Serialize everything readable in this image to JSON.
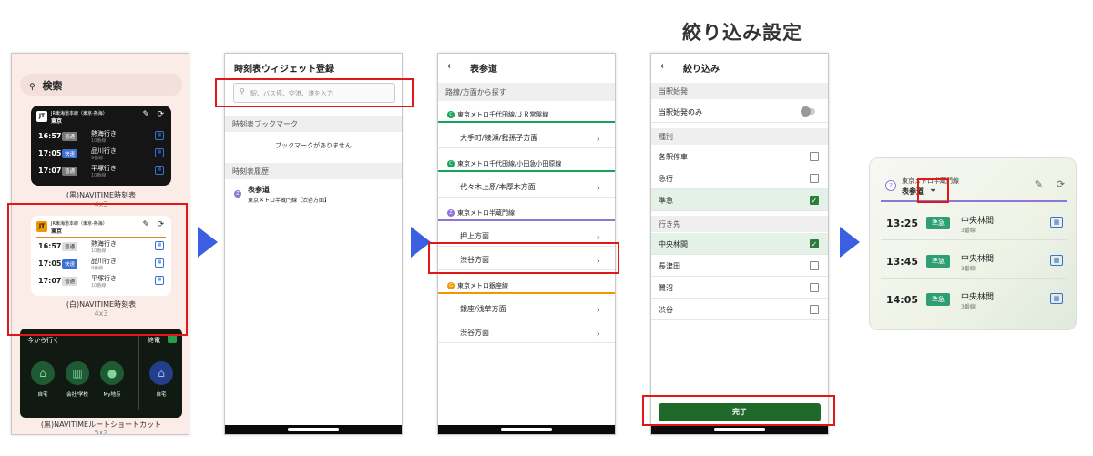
{
  "heading": "絞り込み設定",
  "colors": {
    "accent": "#2c7d3a",
    "highlight": "#e01818",
    "arrow": "#3a5fe0",
    "chiyoda": "#19a35a",
    "hanzomon": "#8f76d6",
    "ginza": "#f39700"
  },
  "phone1": {
    "search_label": "検索",
    "widget_dark": {
      "line": "JR東海道本線（東京-熱海）",
      "station": "東京",
      "rows": [
        {
          "time": "16:57",
          "type": "普通",
          "dest": "熱海行き",
          "track": "10番線"
        },
        {
          "time": "17:05",
          "type": "快速",
          "dest": "品川行き",
          "track": "9番線"
        },
        {
          "time": "17:07",
          "type": "普通",
          "dest": "平塚行き",
          "track": "10番線"
        }
      ],
      "label": "(黒)NAVITIME時刻表",
      "size": "4x3"
    },
    "widget_light": {
      "line": "JR東海道本線（東京-熱海）",
      "station": "東京",
      "rows": [
        {
          "time": "16:57",
          "type": "普通",
          "dest": "熱海行き",
          "track": "10番線"
        },
        {
          "time": "17:05",
          "type": "快速",
          "dest": "品川行き",
          "track": "9番線"
        },
        {
          "time": "17:07",
          "type": "普通",
          "dest": "平塚行き",
          "track": "10番線"
        }
      ],
      "label": "(白)NAVITIME時刻表",
      "size": "4x3"
    },
    "shortcut": {
      "title": "今から行く",
      "last_train": "終電",
      "items": [
        "自宅",
        "会社/学校",
        "My地点",
        "自宅"
      ],
      "label": "(黒)NAVITIMEルートショートカット",
      "size": "5x2"
    }
  },
  "phone2": {
    "title": "時刻表ウィジェット登録",
    "search_placeholder": "駅、バス停、空港、港を入力",
    "bookmark_header": "時刻表ブックマーク",
    "bookmark_empty": "ブックマークがありません",
    "history_header": "時刻表履歴",
    "history_station": "表参道",
    "history_line": "東京メトロ半蔵門線【渋谷方面】"
  },
  "phone3": {
    "title": "表参道",
    "section": "路線/方面から探す",
    "lines": [
      {
        "badge": "C",
        "name": "東京メトロ千代田線/ＪＲ常盤線",
        "directions": [
          "大手町/綾瀬/我孫子方面"
        ]
      },
      {
        "badge": "C",
        "name": "東京メトロ千代田線/小田急小田原線",
        "directions": [
          "代々木上原/本厚木方面"
        ]
      },
      {
        "badge": "Z",
        "name": "東京メトロ半蔵門線",
        "directions": [
          "押上方面",
          "渋谷方面"
        ]
      },
      {
        "badge": "G",
        "name": "東京メトロ銀座線",
        "directions": [
          "銀座/浅草方面",
          "渋谷方面"
        ]
      }
    ]
  },
  "phone4": {
    "title": "絞り込み",
    "origin_header": "当駅始発",
    "origin_only": "当駅始発のみ",
    "type_header": "種別",
    "types": [
      {
        "label": "各駅停車",
        "checked": false
      },
      {
        "label": "急行",
        "checked": false
      },
      {
        "label": "準急",
        "checked": true
      }
    ],
    "dest_header": "行き先",
    "dests": [
      {
        "label": "中央林間",
        "checked": true
      },
      {
        "label": "長津田",
        "checked": false
      },
      {
        "label": "鷺沼",
        "checked": false
      },
      {
        "label": "渋谷",
        "checked": false
      }
    ],
    "done_button": "完了"
  },
  "result_widget": {
    "line": "東京メトロ半蔵門線",
    "station": "表参道",
    "rows": [
      {
        "time": "13:25",
        "type": "準急",
        "dest": "中央林間",
        "track": "3番線"
      },
      {
        "time": "13:45",
        "type": "準急",
        "dest": "中央林間",
        "track": "3番線"
      },
      {
        "time": "14:05",
        "type": "準急",
        "dest": "中央林間",
        "track": "3番線"
      }
    ]
  }
}
